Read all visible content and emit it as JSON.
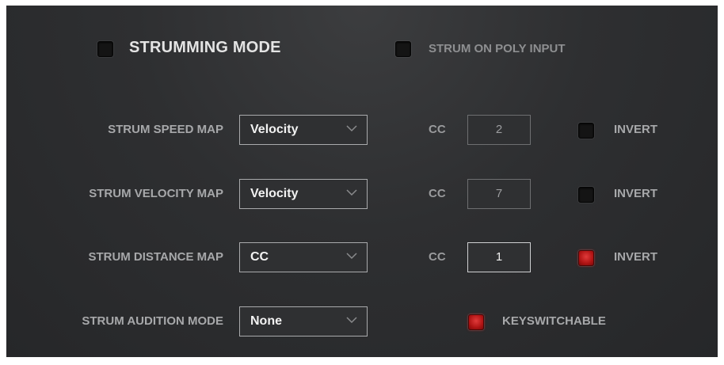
{
  "header": {
    "strumming_mode": {
      "label": "STRUMMING MODE",
      "checked": false
    },
    "strum_on_poly_input": {
      "label": "STRUM ON POLY INPUT",
      "checked": false
    }
  },
  "rows": [
    {
      "label": "STRUM SPEED MAP",
      "select": "Velocity",
      "cc_label": "CC",
      "cc_value": "2",
      "cc_active": false,
      "invert_label": "INVERT",
      "invert_checked": false
    },
    {
      "label": "STRUM VELOCITY MAP",
      "select": "Velocity",
      "cc_label": "CC",
      "cc_value": "7",
      "cc_active": false,
      "invert_label": "INVERT",
      "invert_checked": false
    },
    {
      "label": "STRUM DISTANCE MAP",
      "select": "CC",
      "cc_label": "CC",
      "cc_value": "1",
      "cc_active": true,
      "invert_label": "INVERT",
      "invert_checked": true
    }
  ],
  "audition": {
    "label": "STRUM AUDITION MODE",
    "select": "None"
  },
  "keyswitchable": {
    "label": "KEYSWITCHABLE",
    "checked": true
  },
  "colors": {
    "accent_red": "#c41a1a",
    "panel": "#2e2f31"
  },
  "icons": {
    "dropdown": "chevron-down-icon"
  }
}
